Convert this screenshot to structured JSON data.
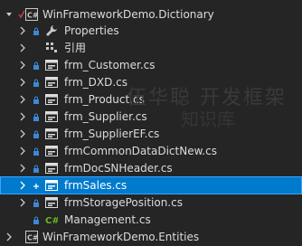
{
  "colors": {
    "background": "#252526",
    "selected": "#007acc",
    "csharp_green": "#68b723",
    "form_icon": "#dcdcdc",
    "lock_blue": "#3c88d6"
  },
  "tree": {
    "project": {
      "label": "WinFrameworkDemo.Dictionary",
      "icon": "csharp-project-icon"
    },
    "items": [
      {
        "label": "Properties",
        "icon": "wrench-icon"
      },
      {
        "label": "引用",
        "icon": "references-icon"
      },
      {
        "label": "frm_Customer.cs",
        "icon": "form-icon"
      },
      {
        "label": "frm_DXD.cs",
        "icon": "form-icon"
      },
      {
        "label": "frm_Product.cs",
        "icon": "form-icon"
      },
      {
        "label": "frm_Supplier.cs",
        "icon": "form-icon"
      },
      {
        "label": "frm_SupplierEF.cs",
        "icon": "form-icon"
      },
      {
        "label": "frmCommonDataDictNew.cs",
        "icon": "form-icon"
      },
      {
        "label": "frmDocSNHeader.cs",
        "icon": "form-icon"
      },
      {
        "label": "frmSales.cs",
        "icon": "form-icon"
      },
      {
        "label": "frmStoragePosition.cs",
        "icon": "form-icon"
      },
      {
        "label": "Management.cs",
        "icon": "csharp-file-icon"
      }
    ],
    "next_project": {
      "label": "WinFrameworkDemo.Entities",
      "icon": "csharp-project-icon"
    }
  },
  "watermark": {
    "line1": "伍华聪 开发框架",
    "line2": "知识库"
  }
}
